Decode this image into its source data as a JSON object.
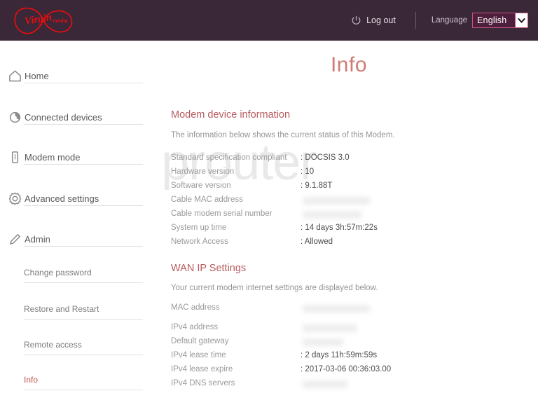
{
  "header": {
    "logo_name": "virgin-media-logo",
    "logo_word": "Virgin",
    "logo_sub": "media",
    "logout_label": "Log out",
    "logout_icon": "power-icon",
    "language_label": "Language",
    "language_value": "English",
    "language_arrow_icon": "chevron-down-icon",
    "bg_color": "#3a2738",
    "accent_color": "#c2557d"
  },
  "watermark": {
    "text": "setuprouter"
  },
  "sidebar": {
    "items": [
      {
        "label": "Home",
        "icon": "home-icon",
        "type": "main",
        "active": false
      },
      {
        "label": "Connected devices",
        "icon": "devices-icon",
        "type": "main",
        "active": false
      },
      {
        "label": "Modem mode",
        "icon": "modem-icon",
        "type": "main",
        "active": false
      },
      {
        "label": "Advanced settings",
        "icon": "gear-icon",
        "type": "main",
        "active": false
      },
      {
        "label": "Admin",
        "icon": "pencil-icon",
        "type": "main",
        "active": false
      },
      {
        "label": "Change password",
        "icon": "",
        "type": "sub",
        "active": false
      },
      {
        "label": "Restore and Restart",
        "icon": "",
        "type": "sub",
        "active": false
      },
      {
        "label": "Remote access",
        "icon": "",
        "type": "sub",
        "active": false
      },
      {
        "label": "Info",
        "icon": "",
        "type": "sub",
        "active": true
      }
    ],
    "active_color": "#c25a52"
  },
  "main": {
    "page_title": "Info",
    "sections": [
      {
        "title": "Modem device information",
        "description": "The information below shows the current status of this Modem.",
        "rows": [
          {
            "key": "Standard specification compliant",
            "value": ": DOCSIS 3.0",
            "redacted": false
          },
          {
            "key": "Hardware version",
            "value": ": 10",
            "redacted": false
          },
          {
            "key": "Software version",
            "value": ": 9.1.88T",
            "redacted": false
          },
          {
            "key": "Cable MAC address",
            "value": "",
            "redacted": true,
            "redact_width": 96
          },
          {
            "key": "Cable modem serial number",
            "value": "",
            "redacted": true,
            "redact_width": 84
          },
          {
            "key": "System up time",
            "value": ": 14 days 3h:57m:22s",
            "redacted": false
          },
          {
            "key": "Network Access",
            "value": ": Allowed",
            "redacted": false
          }
        ]
      },
      {
        "title": "WAN IP Settings",
        "description": "Your current modem internet settings are displayed below.",
        "rows": [
          {
            "key": "MAC address",
            "value": "",
            "redacted": true,
            "redact_width": 96
          },
          {
            "key": "IPv4 address",
            "value": "",
            "redacted": true,
            "redact_width": 78
          },
          {
            "key": "Default gateway",
            "value": "",
            "redacted": true,
            "redact_width": 58
          },
          {
            "key": "IPv4 lease time",
            "value": ": 2 days 11h:59m:59s",
            "redacted": false
          },
          {
            "key": "IPv4 lease expire",
            "value": ": 2017-03-06 00:36:03.00",
            "redacted": false
          },
          {
            "key": "IPv4 DNS servers",
            "value": "",
            "redacted": true,
            "redact_width": 64
          }
        ]
      }
    ]
  }
}
